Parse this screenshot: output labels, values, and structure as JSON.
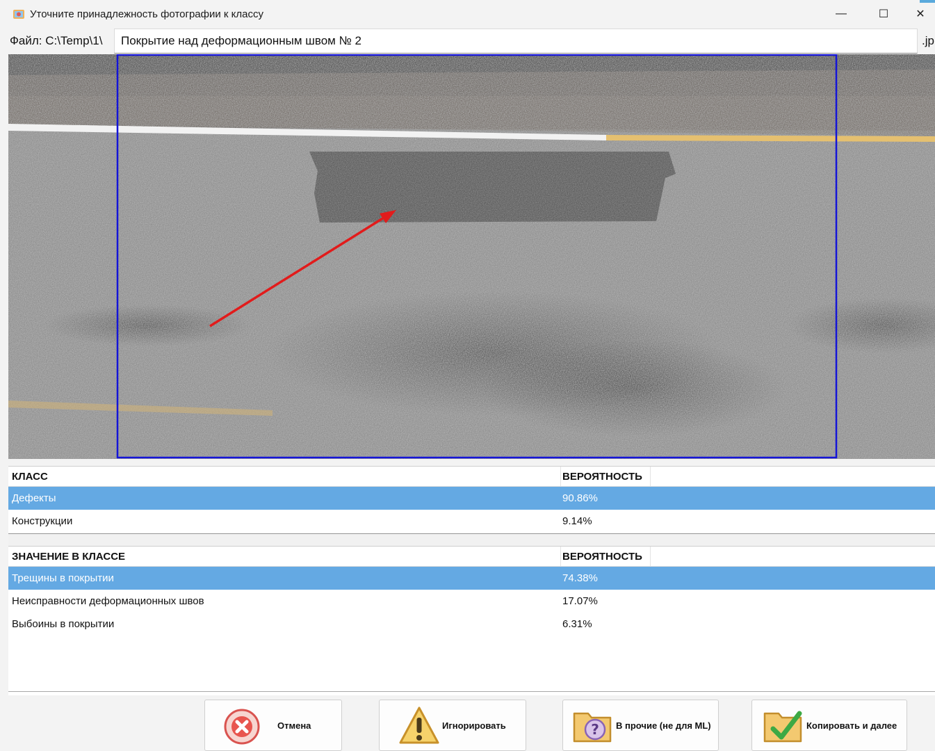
{
  "window": {
    "title": "Уточните принадлежность фотографии к классу",
    "minimize_glyph": "—",
    "maximize_glyph": "☐",
    "close_glyph": "✕"
  },
  "file": {
    "label": "Файл: C:\\Temp\\1\\",
    "name_value": "Покрытие над деформационным швом № 2",
    "extension": ".jp"
  },
  "colors": {
    "selection": "#64a9e3",
    "frame": "#1414d8",
    "arrow": "#e21b1b"
  },
  "class_table": {
    "headers": [
      "КЛАСС",
      "ВЕРОЯТНОСТЬ"
    ],
    "rows": [
      {
        "name": "Дефекты",
        "probability": "90.86%",
        "selected": true
      },
      {
        "name": "Конструкции",
        "probability": "9.14%",
        "selected": false
      }
    ]
  },
  "value_table": {
    "headers": [
      "ЗНАЧЕНИЕ В КЛАССЕ",
      "ВЕРОЯТНОСТЬ"
    ],
    "rows": [
      {
        "name": "Трещины в покрытии",
        "probability": "74.38%",
        "selected": true
      },
      {
        "name": "Неисправности деформационных швов",
        "probability": "17.07%",
        "selected": false
      },
      {
        "name": "Выбоины в покрытии",
        "probability": "6.31%",
        "selected": false
      }
    ]
  },
  "buttons": {
    "cancel": {
      "label": "Отмена",
      "icon": "cancel-x-icon"
    },
    "ignore": {
      "label": "Игнорировать",
      "icon": "warning-icon"
    },
    "other": {
      "label": "В прочие (не для ML)",
      "icon": "question-folder-icon"
    },
    "copy_next": {
      "label": "Копировать и далее",
      "icon": "checkmark-folder-icon"
    }
  }
}
